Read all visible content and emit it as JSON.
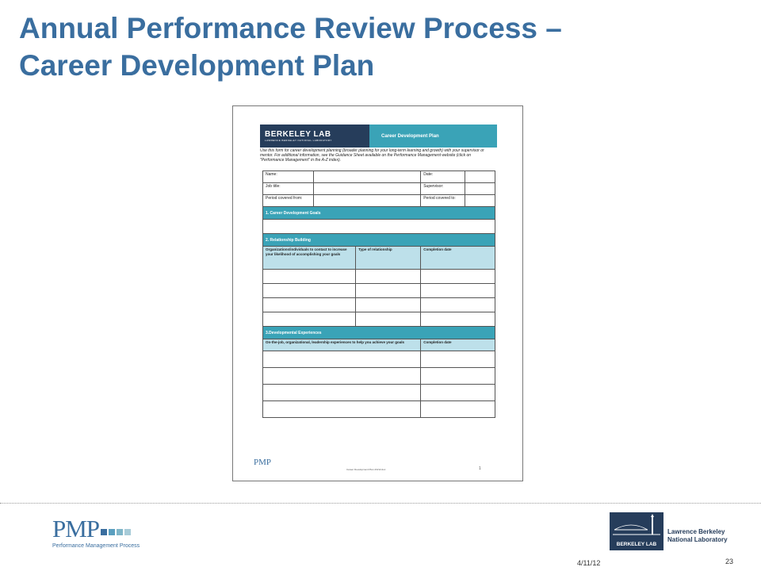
{
  "slide": {
    "title_line1": "Annual Performance Review Process –",
    "title_line2": "Career Development Plan",
    "date": "4/11/12",
    "page_number": "23"
  },
  "document": {
    "header_logo": "BERKELEY LAB",
    "header_logo_sub": "LAWRENCE BERKELEY NATIONAL LABORATORY",
    "header_title": "Career Development Plan",
    "intro": "Use this form for career development planning (broader planning for your long-term learning and growth) with your supervisor or mentor. For additional information, see the Guidance Sheet available on the Performance Management website (click on \"Performance Management\" in the A-Z index).",
    "fields": {
      "name": "Name:",
      "date": "Date:",
      "job_title": "Job title:",
      "supervisor": "Supervisor:",
      "period_from": "Period covered from:",
      "period_to": "Period covered to:"
    },
    "section1": "1. Career Development Goals",
    "section2": "2. Relationship Building",
    "section2_cols": [
      "Organizations/individuals to contact to increase your likelihood of accomplishing your goals",
      "Type of relationship",
      "Completion date"
    ],
    "section3": "3.Developmental Experiences",
    "section3_cols": [
      "On-the-job, organizational, leadership experiences to help you achieve your goals",
      "Completion date"
    ],
    "footer_logo": "PMP",
    "footer_text": "Career Development Plan 4/4/12.doc",
    "footer_page": "1"
  },
  "logos": {
    "pmp_letters": "PMP",
    "pmp_tagline": "Performance Management Process",
    "pmp_square_colors": [
      "#3a6e9f",
      "#5a9fbf",
      "#7fb6c9",
      "#a7cbd8"
    ],
    "lbl_logo_text": "BERKELEY LAB",
    "lbl_name_line1": "Lawrence Berkeley",
    "lbl_name_line2": "National Laboratory"
  },
  "colors": {
    "title": "#3a6e9f",
    "teal": "#3aa3b7",
    "navy": "#263d5b",
    "light_blue": "#bde0ea"
  }
}
